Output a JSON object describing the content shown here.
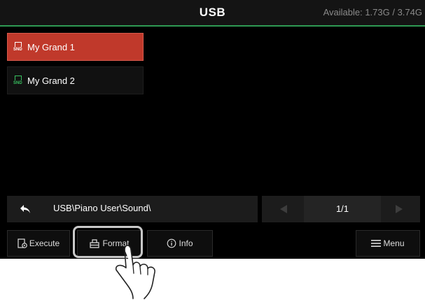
{
  "header": {
    "title": "USB",
    "available": "Available: 1.73G / 3.74G"
  },
  "files": [
    {
      "icon": "snd-file-icon",
      "name": "My Grand 1",
      "selected": true
    },
    {
      "icon": "snd-file-icon",
      "name": "My Grand 2",
      "selected": false
    }
  ],
  "snd_icon_text": "SND",
  "path": "USB\\Piano User\\Sound\\",
  "pager": {
    "page": "1/1"
  },
  "buttons": {
    "execute": "Execute",
    "format": "Format",
    "info": "Info",
    "menu": "Menu"
  },
  "colors": {
    "selected": "#c0392b",
    "accent_line": "#2f9a54",
    "snd_green": "#38c060"
  }
}
